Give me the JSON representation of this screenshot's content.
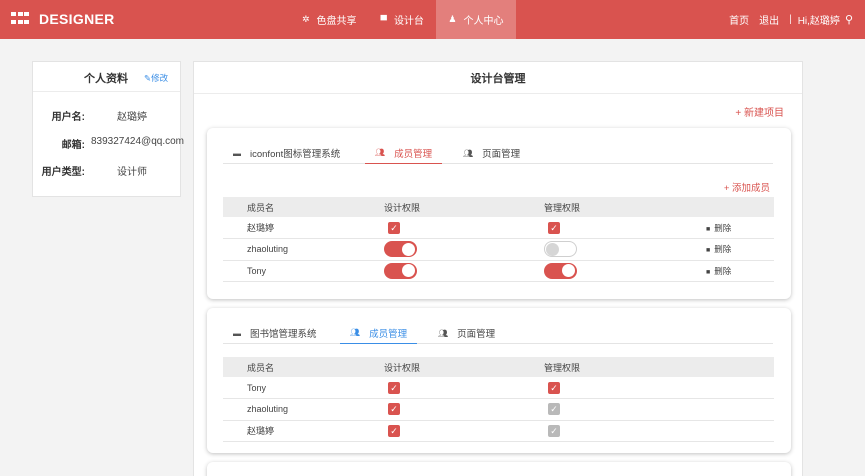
{
  "header": {
    "logo_text": "DESIGNER",
    "nav": [
      {
        "label": "色盘共享",
        "icon": "palette-icon",
        "glyph": "✲"
      },
      {
        "label": "设计台",
        "icon": "desk-icon",
        "glyph": "▀"
      },
      {
        "label": "个人中心",
        "icon": "user-icon",
        "glyph": "♟"
      }
    ],
    "home": "首页",
    "logout": "退出",
    "separator": "|",
    "greeting": "Hi,赵璐婷",
    "search_glyph": "⚲"
  },
  "profile": {
    "title": "个人资料",
    "edit_label": "修改",
    "username_label": "用户名:",
    "username": "赵璐婷",
    "email_label": "邮箱:",
    "email": "839327424@qq.com",
    "usertype_label": "用户类型:",
    "usertype": "设计师"
  },
  "main": {
    "title": "设计台管理",
    "new_project": "+ 新建项目",
    "projects": [
      {
        "tabs": [
          "iconfont图标管理系统",
          "成员管理",
          "页面管理"
        ],
        "add_member": "+ 添加成员",
        "columns": [
          "成员名",
          "设计权限",
          "管理权限"
        ],
        "members": [
          {
            "name": "赵璐婷",
            "design": "checkbox-checked",
            "admin": "checkbox-checked",
            "action": "删除"
          },
          {
            "name": "zhaoluting",
            "design": "toggle-on",
            "admin": "toggle-off",
            "action": "删除"
          },
          {
            "name": "Tony",
            "design": "toggle-on",
            "admin": "toggle-on",
            "action": "删除"
          }
        ]
      },
      {
        "tabs": [
          "图书馆管理系统",
          "成员管理",
          "页面管理"
        ],
        "columns": [
          "成员名",
          "设计权限",
          "管理权限"
        ],
        "members": [
          {
            "name": "Tony",
            "design": "checkbox-checked",
            "admin": "checkbox-checked"
          },
          {
            "name": "zhaoluting",
            "design": "checkbox-checked",
            "admin": "checkbox-disabled"
          },
          {
            "name": "赵璐婷",
            "design": "checkbox-checked",
            "admin": "checkbox-disabled"
          }
        ]
      }
    ]
  },
  "colors": {
    "brand": "#d9534f",
    "link": "#3a8ee6"
  }
}
